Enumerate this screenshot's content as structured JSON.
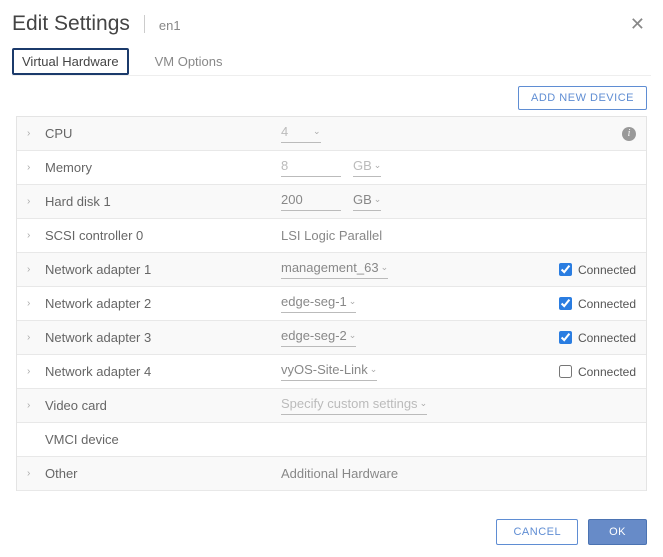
{
  "header": {
    "title": "Edit Settings",
    "subtitle": "en1"
  },
  "tabs": [
    {
      "label": "Virtual Hardware",
      "active": true
    },
    {
      "label": "VM Options",
      "active": false
    }
  ],
  "toolbar": {
    "add_device": "ADD NEW DEVICE"
  },
  "rows": {
    "cpu": {
      "label": "CPU",
      "value": "4"
    },
    "memory": {
      "label": "Memory",
      "value": "8",
      "unit": "GB"
    },
    "hard_disk": {
      "label": "Hard disk 1",
      "value": "200",
      "unit": "GB"
    },
    "scsi": {
      "label": "SCSI controller 0",
      "value": "LSI Logic Parallel"
    },
    "net1": {
      "label": "Network adapter 1",
      "value": "management_63",
      "connected_label": "Connected",
      "connected": true
    },
    "net2": {
      "label": "Network adapter 2",
      "value": "edge-seg-1",
      "connected_label": "Connected",
      "connected": true
    },
    "net3": {
      "label": "Network adapter 3",
      "value": "edge-seg-2",
      "connected_label": "Connected",
      "connected": true
    },
    "net4": {
      "label": "Network adapter 4",
      "value": "vyOS-Site-Link",
      "connected_label": "Connected",
      "connected": false
    },
    "video": {
      "label": "Video card",
      "value": "Specify custom settings"
    },
    "vmci": {
      "label": "VMCI device"
    },
    "other": {
      "label": "Other",
      "value": "Additional Hardware"
    }
  },
  "footer": {
    "cancel": "CANCEL",
    "ok": "OK"
  }
}
